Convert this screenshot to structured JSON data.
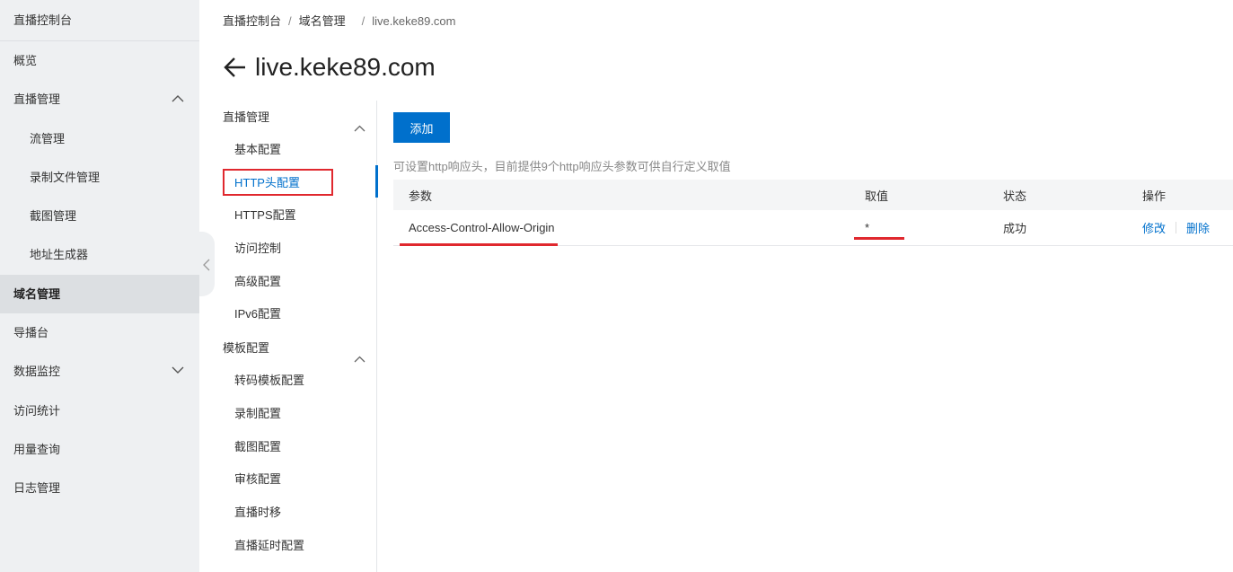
{
  "sidebar": {
    "title": "直播控制台",
    "items": [
      {
        "label": "概览"
      },
      {
        "label": "直播管理"
      },
      {
        "label": "流管理"
      },
      {
        "label": "录制文件管理"
      },
      {
        "label": "截图管理"
      },
      {
        "label": "地址生成器"
      },
      {
        "label": "域名管理"
      },
      {
        "label": "导播台"
      },
      {
        "label": "数据监控"
      },
      {
        "label": "访问统计"
      },
      {
        "label": "用量查询"
      },
      {
        "label": "日志管理"
      }
    ]
  },
  "breadcrumb": {
    "root": "直播控制台",
    "sep": "/",
    "section": "域名管理",
    "current": "live.keke89.com"
  },
  "page": {
    "title": "live.keke89.com"
  },
  "subnav": {
    "group1": "直播管理",
    "group1_items": [
      "基本配置",
      "HTTP头配置",
      "HTTPS配置",
      "访问控制",
      "高级配置",
      "IPv6配置"
    ],
    "group2": "模板配置",
    "group2_items": [
      "转码模板配置",
      "录制配置",
      "截图配置",
      "审核配置",
      "直播时移",
      "直播延时配置"
    ]
  },
  "content": {
    "add_button": "添加",
    "hint": "可设置http响应头，目前提供9个http响应头参数可供自行定义取值",
    "table": {
      "headers": {
        "param": "参数",
        "value": "取值",
        "status": "状态",
        "ops": "操作"
      },
      "rows": [
        {
          "param": "Access-Control-Allow-Origin",
          "value": "*",
          "status": "成功",
          "edit": "修改",
          "delete": "删除"
        }
      ]
    }
  },
  "colors": {
    "accent": "#0070cc",
    "annotation": "#e0282e"
  }
}
